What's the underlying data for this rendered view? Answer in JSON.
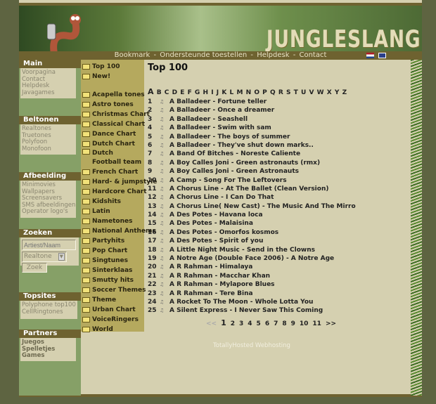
{
  "header": {
    "logo": "JUNGLESLANG",
    "nav": [
      "Bookmark",
      "Ondersteunde toestellen",
      "Helpdesk",
      "Contact"
    ],
    "nav_sep": " - ",
    "flags": [
      "nl-flag",
      "uk-flag"
    ]
  },
  "sidebar": {
    "main": {
      "title": "Main",
      "items": [
        "Voorpagina",
        "Contact",
        "Helpdesk",
        "Javagames"
      ]
    },
    "beltonen": {
      "title": "Beltonen",
      "items": [
        "Realtones",
        "Truetones",
        "Polyfoon",
        "Monofoon"
      ]
    },
    "afbeelding": {
      "title": "Afbeelding",
      "items": [
        "Minimovies",
        "Wallpapers",
        "Screensavers",
        "SMS afbeeldingen",
        "Operator logo's"
      ]
    },
    "zoeken": {
      "title": "Zoeken",
      "search_placeholder": "Artiest/Naam",
      "select_value": "Realtone",
      "button": "Zoek"
    },
    "topsites": {
      "title": "Topsites",
      "items": [
        "Polyphone top100",
        "CellRingtones"
      ]
    },
    "partners": {
      "title": "Partners",
      "items": [
        "Juegos",
        "Spelletjes",
        "Games"
      ]
    }
  },
  "categories": {
    "top": [
      "Top 100",
      "New!"
    ],
    "items": [
      "Acapella tones",
      "Astro tones",
      "Christmas Chart",
      "Classical Chart",
      "Dance Chart",
      "Dutch Chart",
      "Dutch Football team",
      "French Chart",
      "Hard- & jumpstyle",
      "Hardcore Chart",
      "Kidshits",
      "Latin",
      "Nametones",
      "National Anthems",
      "Partyhits",
      "Pop Chart",
      "Singtunes",
      "Sinterklaas",
      "Smutty hits",
      "Soccer Themes",
      "Theme",
      "Urban Chart",
      "VoiceRingers",
      "World"
    ]
  },
  "main": {
    "title": "Top 100",
    "alphabet": [
      "A",
      "B",
      "C",
      "D",
      "E",
      "F",
      "G",
      "H",
      "I",
      "J",
      "K",
      "L",
      "M",
      "N",
      "O",
      "P",
      "Q",
      "R",
      "S",
      "T",
      "U",
      "V",
      "W",
      "X",
      "Y",
      "Z"
    ],
    "songs": [
      "A Balladeer - Fortune teller",
      "A Balladeer - Once a dreamer",
      "A Balladeer - Seashell",
      "A Balladeer - Swim with sam",
      "A Balladeer - The boys of summer",
      "A Balladeer - They've shut down marks..",
      "A Band Of Bitches - Noreste Caliente",
      "A Boy Calles Joni - Green astronauts (rmx)",
      "A Boy Calles Joni - Green Astronauts",
      "A Camp - Song For The Leftovers",
      "A Chorus Line - At The Ballet (Clean Version)",
      "A Chorus Line - I Can Do That",
      "A Chorus Line( New Cast) - The Music And The Mirro",
      "A Des Potes - Havana loca",
      "A Des Potes - Malaisina",
      "A Des Potes - Omorfos kosmos",
      "A Des Potes - Spirit of you",
      "A Little Night Music - Send in the Clowns",
      "A Notre Age (Double Face 2006) - A Notre Age",
      "A R Rahman - Himalaya",
      "A R Rahman - Macchar Khan",
      "A R Rahman - Mylapore Blues",
      "A R Rahman - Tere Bina",
      "A Rocket To The Moon - Whole Lotta You",
      "A Silent Express - I Never Saw This Coming"
    ],
    "pager": {
      "prev": "<<",
      "pages": [
        "1",
        "2",
        "3",
        "4",
        "5",
        "6",
        "7",
        "8",
        "9",
        "10",
        "11"
      ],
      "current": "1",
      "next": ">>"
    }
  },
  "footer": "TotallyHosted Webhosting"
}
